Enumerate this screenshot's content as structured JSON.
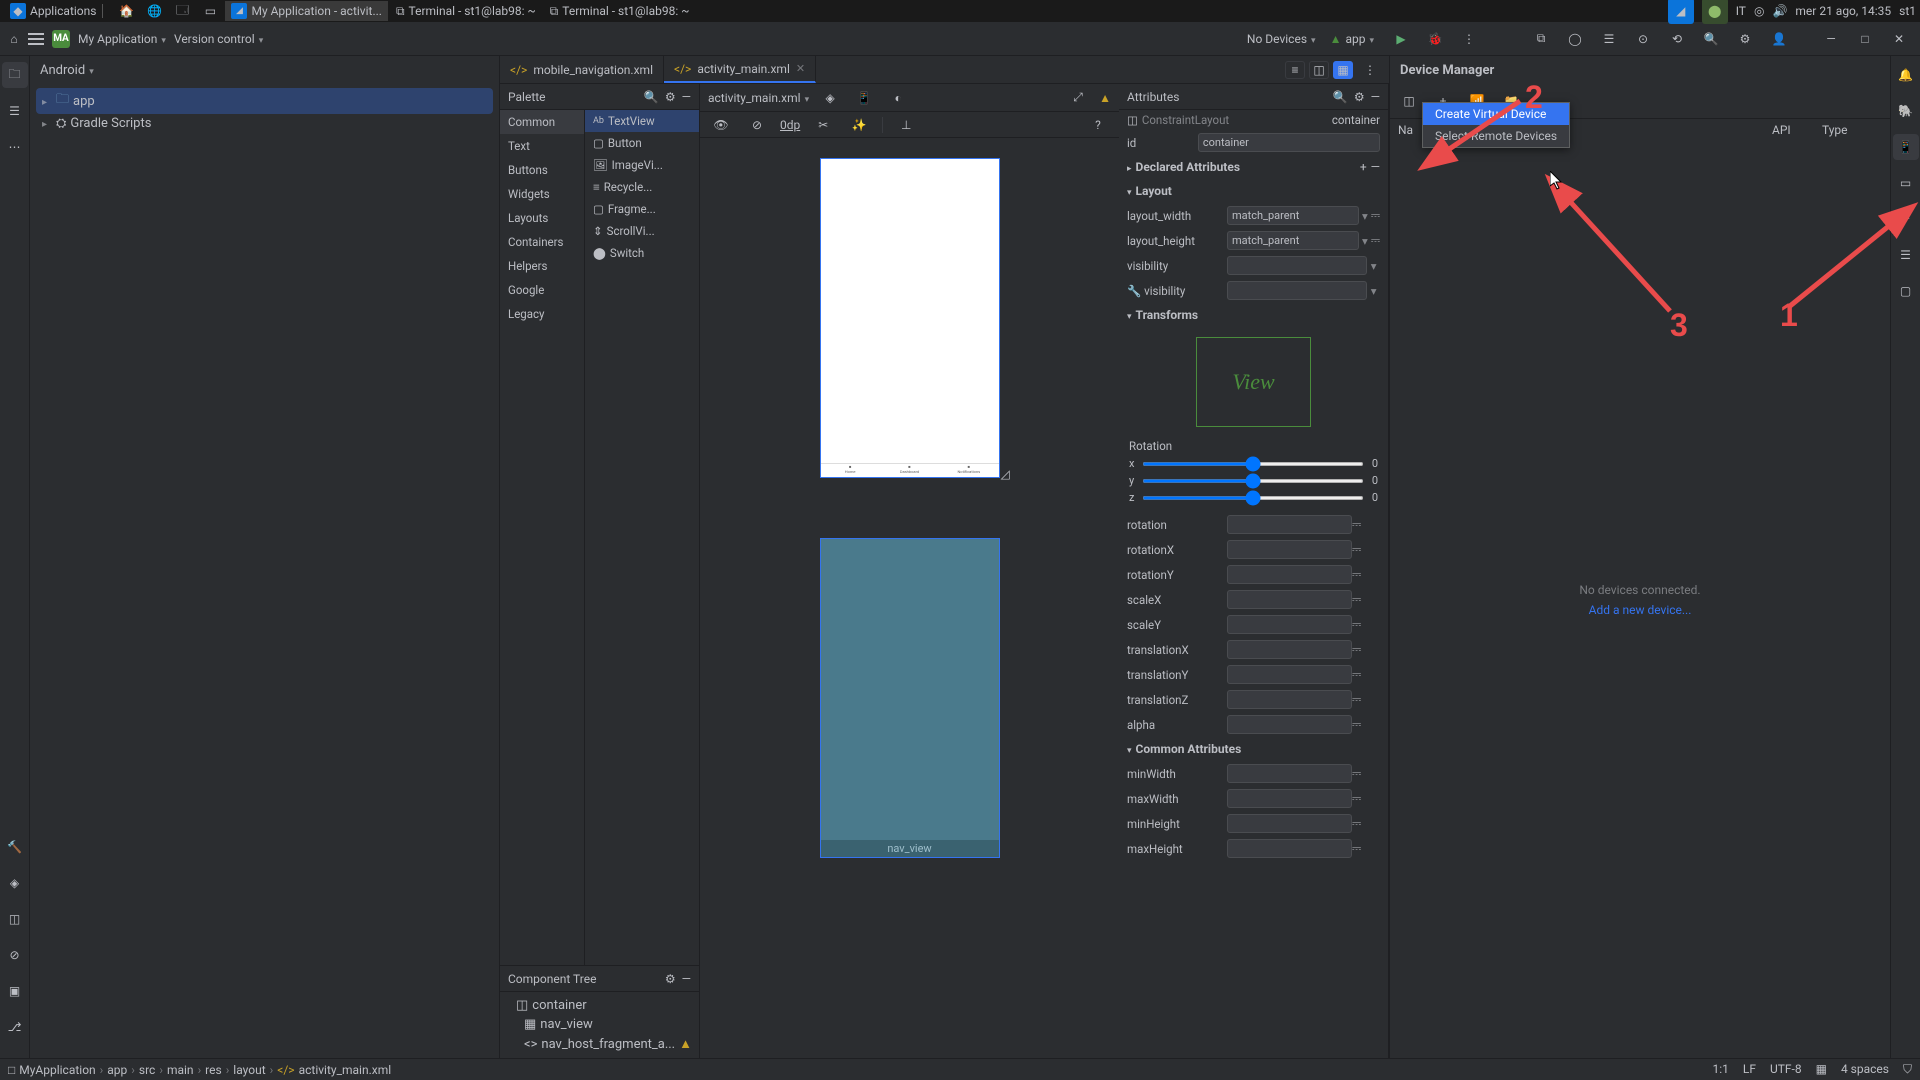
{
  "os": {
    "apps_label": "Applications",
    "taskbar": [
      {
        "label": "My Application - activit..."
      },
      {
        "label": "Terminal - st1@lab98: ~"
      },
      {
        "label": "Terminal - st1@lab98: ~"
      }
    ],
    "lang": "IT",
    "clock": "mer 21 ago, 14:35",
    "user": "st1"
  },
  "ide": {
    "project_badge": "MA",
    "project_name": "My Application",
    "vcs": "Version control",
    "device_sel": "No Devices",
    "module": "app"
  },
  "project_view": {
    "mode": "Android",
    "nodes": [
      {
        "label": "app"
      },
      {
        "label": "Gradle Scripts"
      }
    ]
  },
  "tabs": [
    {
      "label": "mobile_navigation.xml",
      "active": false
    },
    {
      "label": "activity_main.xml",
      "active": true
    }
  ],
  "palette": {
    "title": "Palette",
    "categories": [
      "Common",
      "Text",
      "Buttons",
      "Widgets",
      "Layouts",
      "Containers",
      "Helpers",
      "Google",
      "Legacy"
    ],
    "items": [
      "TextView",
      "Button",
      "ImageVi...",
      "Recycle...",
      "Fragme...",
      "ScrollVi...",
      "Switch"
    ]
  },
  "component_tree": {
    "title": "Component Tree",
    "nodes": [
      "container",
      "nav_view",
      "nav_host_fragment_a..."
    ]
  },
  "canvas": {
    "file": "activity_main.xml",
    "margin": "0dp",
    "nav_label": "nav_view"
  },
  "attributes": {
    "title": "Attributes",
    "root_type": "ConstraintLayout",
    "root_name": "container",
    "id": "container",
    "sections": {
      "declared": "Declared Attributes",
      "layout": "Layout",
      "transforms": "Transforms",
      "rotation_title": "Rotation",
      "common": "Common Attributes"
    },
    "layout": {
      "width_label": "layout_width",
      "width_val": "match_parent",
      "height_label": "layout_height",
      "height_val": "match_parent",
      "visibility_label": "visibility",
      "visibility2_label": "visibility"
    },
    "view_text": "View",
    "rotation": {
      "x": "x",
      "y": "y",
      "z": "z",
      "x_val": "0",
      "y_val": "0",
      "z_val": "0"
    },
    "transform_props": [
      "rotation",
      "rotationX",
      "rotationY",
      "scaleX",
      "scaleY",
      "translationX",
      "translationY",
      "translationZ",
      "alpha"
    ],
    "common_props": [
      "minWidth",
      "maxWidth",
      "minHeight",
      "maxHeight"
    ]
  },
  "devmgr": {
    "title": "Device Manager",
    "cols": {
      "name": "Na",
      "api": "API",
      "type": "Type"
    },
    "popup": {
      "create": "Create Virtual Device",
      "remote": "Select Remote Devices"
    },
    "empty": "No devices connected.",
    "add": "Add a new device..."
  },
  "annotations": {
    "n1": "1",
    "n2": "2",
    "n3": "3"
  },
  "breadcrumb": [
    "MyApplication",
    "app",
    "src",
    "main",
    "res",
    "layout",
    "activity_main.xml"
  ],
  "statusbar": {
    "pos": "1:1",
    "enc": "LF",
    "charset": "UTF-8",
    "indent": "4 spaces"
  }
}
